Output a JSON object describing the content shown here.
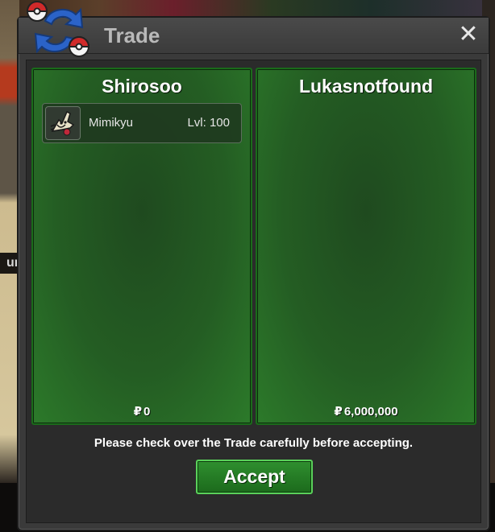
{
  "window": {
    "title": "Trade",
    "close_symbol": "✕"
  },
  "background": {
    "left_label": "ur"
  },
  "trade": {
    "left_trader": {
      "name": "Shirosoo",
      "currency_symbol": "₽",
      "money": "0",
      "items": [
        {
          "name": "Mimikyu",
          "level": "Lvl: 100",
          "icon": "mimikyu-sprite-icon"
        }
      ]
    },
    "right_trader": {
      "name": "Lukasnotfound",
      "currency_symbol": "₽",
      "money": "6,000,000",
      "items": []
    },
    "notice": "Please check over the Trade carefully before accepting.",
    "accept_label": "Accept"
  },
  "colors": {
    "panel_green": "#245d23",
    "accept_green": "#2f8f2f",
    "accept_border": "#5ad15a",
    "window_bg": "#3a3a3a"
  },
  "icons": {
    "logo": "pokeball-trade-arrows-icon",
    "close": "close-icon",
    "currency": "pokedollar-icon"
  }
}
